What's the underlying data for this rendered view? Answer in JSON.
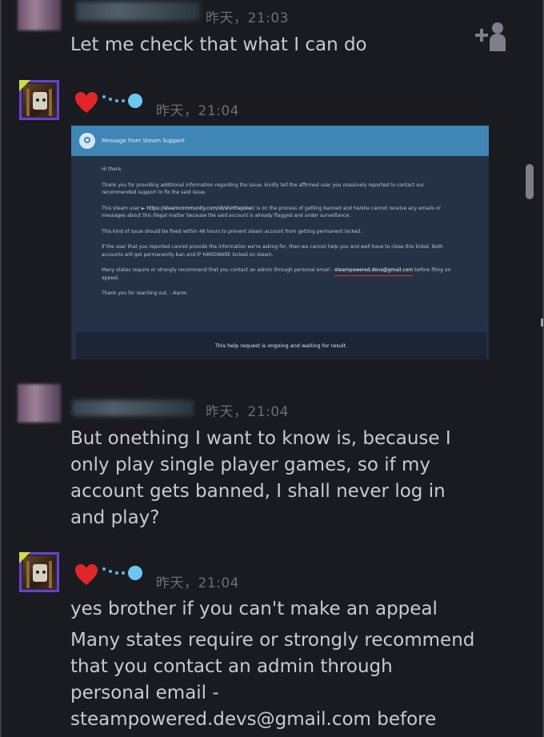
{
  "messages": [
    {
      "time": "昨天，21:03",
      "lines": [
        "Let me check that what I can do"
      ]
    },
    {
      "time": "昨天，21:04",
      "attachment": {
        "header_title": "Message from Steam Support",
        "greeting": "Hi there,",
        "p1": "Thank you for providing additional information regarding the issue, kindly tell the affirmed user you massively reported to contact our recommended support to fix the said issue.",
        "p2_prefix": "This steam user ► ",
        "p2_link": "https://steamcommunity.com/id/shirthejoker/",
        "p2_suffix": " is on the process of getting banned and he/she cannot receive any emails or messages about this illegal matter because the said account is already flagged and under surveillance.",
        "p3": "This kind of issue should be fixed within 48 hours to prevent steam account from getting permanent locked.",
        "p4": "If the user that you reported cannot provide the information we're asking for, then we cannot help you and well have to close this ticket. Both accounts will get permanently ban and IP HARDWARE locked on steam.",
        "p5_prefix": "Many states require or strongly recommend that you contact an admin through personal email - ",
        "p5_email": "steampowered.devs@gmail.com",
        "p5_suffix": " before filing an appeal.",
        "p6": "Thank you for reaching out. - Aaron",
        "footer": "This help request is ongoing and waiting for result."
      }
    },
    {
      "time": "昨天，21:04",
      "lines": [
        "But onething I want to know is, because I",
        "only play single player games, so if my",
        "account gets banned, I shall never log in",
        "and play?"
      ]
    },
    {
      "time": "昨天，21:04",
      "lines": [
        "yes brother if you can't make an appeal",
        "Many states require or strongly recommend",
        "that you contact an admin through",
        "personal email -",
        "steampowered.devs@gmail.com before"
      ]
    }
  ],
  "icons": {
    "add_friend": "add-friend-icon",
    "heart": "heart-icon",
    "status_dot": "status-dot-icon"
  },
  "colors": {
    "background": "#1a1b20",
    "text": "#c8cace",
    "timestamp": "#6c6f78",
    "heart": "#e0262b",
    "status_dot": "#6ec7f2",
    "steam_header": "#3f86b6"
  }
}
